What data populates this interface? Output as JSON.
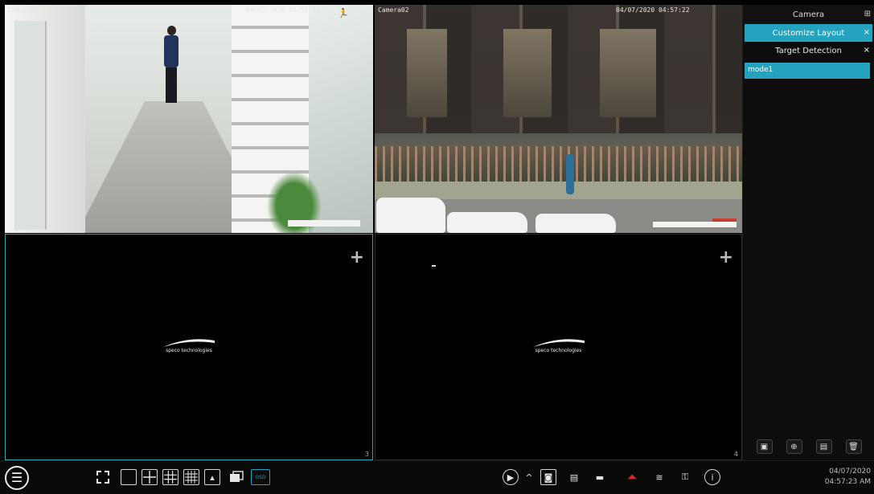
{
  "tiles": [
    {
      "label": "Camera01",
      "time": "04/07/2020 04:57:22",
      "number": ""
    },
    {
      "label": "Camera02",
      "time": "04/07/2020 04:57:22",
      "number": ""
    },
    {
      "label": "",
      "time": "",
      "number": "3",
      "plus": "+",
      "logo_text": "speco technologies"
    },
    {
      "label": "",
      "time": "",
      "number": "4",
      "plus": "+",
      "logo_text": "speco technologies"
    }
  ],
  "panel": {
    "title": "Camera",
    "pin_icon": "pin-icon",
    "rows": [
      {
        "label": "Customize Layout",
        "close": "×",
        "active": true
      },
      {
        "label": "Target Detection",
        "close": "×",
        "active": false
      }
    ],
    "layouts": [
      "mode1"
    ],
    "tools": [
      "save-icon",
      "add-icon",
      "layout-icon",
      "delete-icon"
    ]
  },
  "toolbar": {
    "menu_icon": "menu-icon",
    "layout_tools": [
      "fullscreen-icon",
      "single-layout-icon",
      "quad-layout-icon",
      "nine-layout-icon",
      "sixteen-layout-icon",
      "sequence-icon",
      "layout-more-icon"
    ],
    "osd_label": "OSD",
    "right_tools": [
      "playback-icon",
      "chevron-up-icon",
      "snapshot-icon",
      "record-icon",
      "camera-icon",
      "alarm-icon",
      "disk-icon",
      "network-icon",
      "info-icon"
    ],
    "date": "04/07/2020",
    "time": "04:57:23 AM"
  },
  "colors": {
    "accent": "#23a3bd",
    "alarm": "#e0271f"
  }
}
